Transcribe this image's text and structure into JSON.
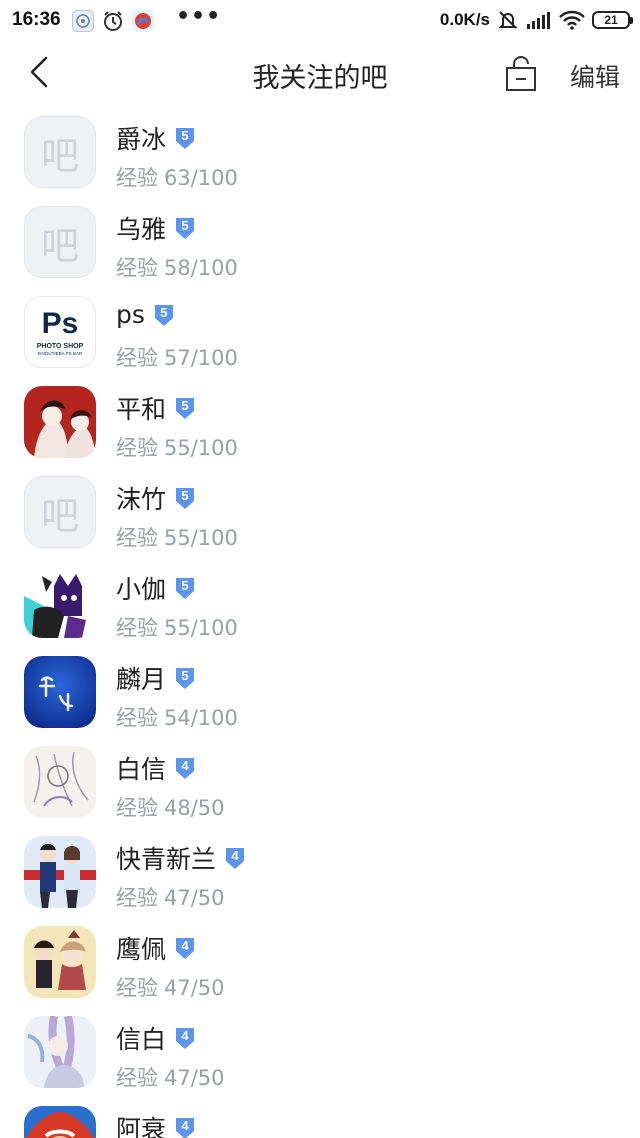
{
  "status_bar": {
    "time": "16:36",
    "net_speed": "0.0K/s",
    "battery": "21",
    "icons": [
      "app-icon-1",
      "alarm-icon",
      "app-icon-2",
      "more-dots-icon",
      "mute-icon",
      "signal-icon",
      "wifi-icon",
      "battery-icon"
    ]
  },
  "header": {
    "title": "我关注的吧",
    "edit_label": "编辑",
    "back_icon": "back-arrow-icon",
    "lock_icon": "lock-icon"
  },
  "placeholder_glyph": "吧",
  "exp_label": "经验",
  "accent": "#5b95ee",
  "forums": [
    {
      "name": "爵冰",
      "level": "5",
      "exp": "63/100",
      "avatar": "placeholder"
    },
    {
      "name": "乌雅",
      "level": "5",
      "exp": "58/100",
      "avatar": "placeholder"
    },
    {
      "name": "ps",
      "level": "5",
      "exp": "57/100",
      "avatar": "ps-logo",
      "logo_text": "Ps",
      "logo_sub": "PHOTO SHOP",
      "logo_sub2": "BAIDUTIEBA PS BAR"
    },
    {
      "name": "平和",
      "level": "5",
      "exp": "55/100",
      "avatar": "red-anime"
    },
    {
      "name": "沫竹",
      "level": "5",
      "exp": "55/100",
      "avatar": "placeholder"
    },
    {
      "name": "小伽",
      "level": "5",
      "exp": "55/100",
      "avatar": "cat-anime"
    },
    {
      "name": "麟月",
      "level": "5",
      "exp": "54/100",
      "avatar": "blue-calligraphy"
    },
    {
      "name": "白信",
      "level": "4",
      "exp": "48/50",
      "avatar": "sketch-anime"
    },
    {
      "name": "快青新兰",
      "level": "4",
      "exp": "47/50",
      "avatar": "couple-anime"
    },
    {
      "name": "鹰佩",
      "level": "4",
      "exp": "47/50",
      "avatar": "yellow-anime"
    },
    {
      "name": "信白",
      "level": "4",
      "exp": "47/50",
      "avatar": "purple-anime"
    },
    {
      "name": "阿衰",
      "level": "4",
      "exp": "",
      "avatar": "red-cartoon"
    }
  ]
}
